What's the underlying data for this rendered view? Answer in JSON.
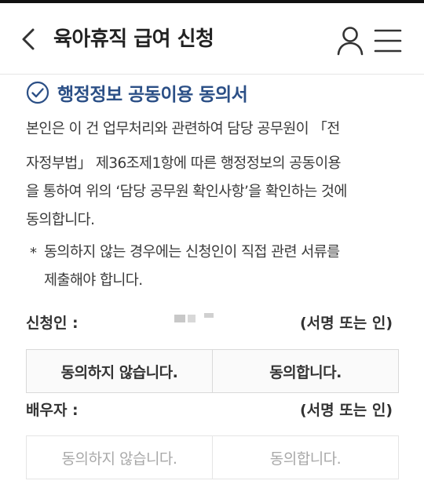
{
  "header": {
    "title": "육아휴직 급여 신청",
    "back_icon": "chevron-left-icon",
    "user_icon": "user-icon",
    "menu_icon": "hamburger-menu-icon"
  },
  "consent": {
    "title": "행정정보 공동이용 동의서",
    "title_color": "#2b4f86",
    "paragraph_lines": [
      "본인은 이 건 업무처리와 관련하여 담당 공무원이 「전",
      "자정부법」 제36조제1항에 따른 행정정보의 공동이용",
      "을 통하여 위의 ‘담당 공무원 확인사항’을 확인하는 것에",
      "동의합니다."
    ],
    "note_marker": "*",
    "note_lines": [
      "동의하지 않는 경우에는 신청인이 직접 관련 서류를",
      "제출해야 합니다."
    ]
  },
  "applicant": {
    "label": "신청인 :",
    "signature_note": "(서명 또는 인)",
    "disagree_label": "동의하지 않습니다.",
    "agree_label": "동의합니다."
  },
  "spouse": {
    "label": "배우자 :",
    "signature_note": "(서명 또는 인)",
    "disagree_label": "동의하지 않습니다.",
    "agree_label": "동의합니다.",
    "disabled": true
  }
}
